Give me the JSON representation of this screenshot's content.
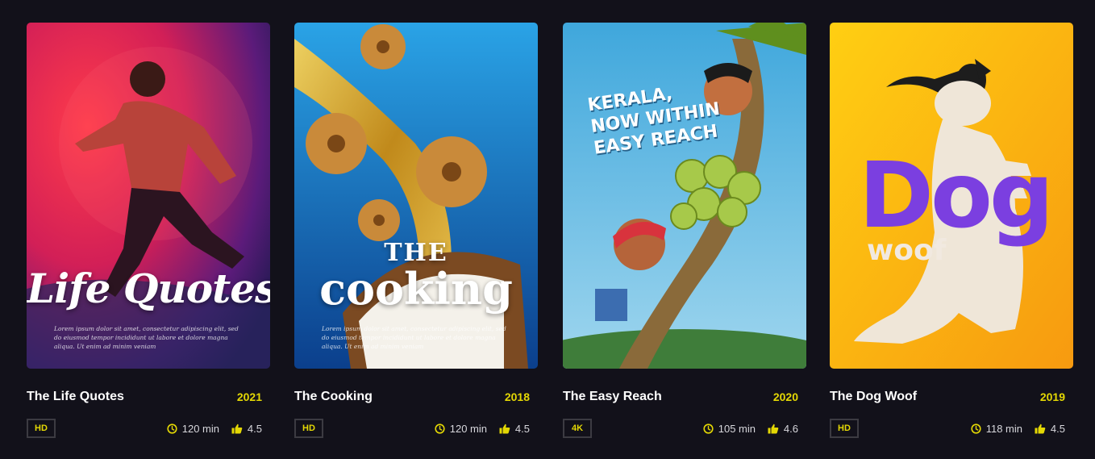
{
  "colors": {
    "background": "#12111a",
    "accent": "#e4d804",
    "badge_border": "#3c3b42"
  },
  "movies": [
    {
      "title": "The Life Quotes",
      "year": "2021",
      "quality": "HD",
      "duration": "120 min",
      "rating": "4.5",
      "poster": {
        "title": "Life Quotes",
        "lorem": "Lorem ipsum dolor sit amet, consectetur adipiscing elit, sed do eiusmod tempor incididunt ut labore et dolore magna aliqua. Ut enim ad minim veniam"
      }
    },
    {
      "title": "The Cooking",
      "year": "2018",
      "quality": "HD",
      "duration": "120 min",
      "rating": "4.5",
      "poster": {
        "title_small": "THE",
        "title": "cooking",
        "lorem": "Lorem ipsum dolor sit amet, consectetur adipiscing elit, sed do eiusmod tempor incididunt ut labore et dolore magna aliqua. Ut enim ad minim veniam"
      }
    },
    {
      "title": "The Easy Reach",
      "year": "2020",
      "quality": "4K",
      "duration": "105 min",
      "rating": "4.6",
      "poster": {
        "title": "KERALA,\nNOW WITHIN\nEASY REACH"
      }
    },
    {
      "title": "The Dog Woof",
      "year": "2019",
      "quality": "HD",
      "duration": "118 min",
      "rating": "4.5",
      "poster": {
        "title": "Dog",
        "subtitle": "woof"
      }
    }
  ],
  "icons": {
    "duration": "clock-icon",
    "rating": "thumbs-up-icon"
  }
}
